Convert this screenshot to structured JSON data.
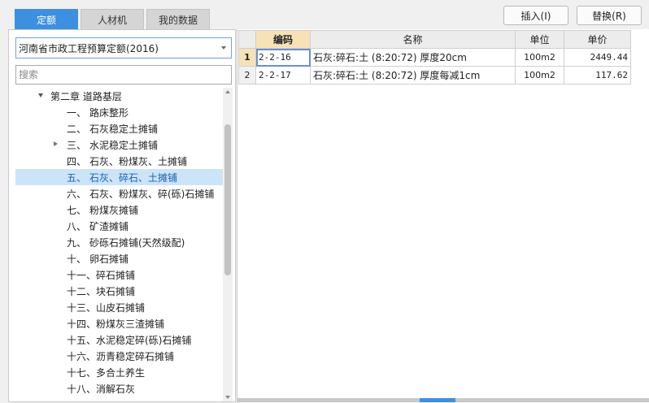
{
  "tabs": [
    {
      "label": "定额",
      "active": true
    },
    {
      "label": "人材机",
      "active": false
    },
    {
      "label": "我的数据",
      "active": false
    }
  ],
  "toolbar": {
    "insert_label": "插入(I)",
    "replace_label": "替换(R)"
  },
  "left": {
    "selected_library": "河南省市政工程预算定额(2016)",
    "search_placeholder": "搜索",
    "tree": [
      {
        "num": "",
        "label": "第二章 道路基层",
        "level": 1,
        "expanded": true
      },
      {
        "num": "一、",
        "label": "路床整形",
        "level": 2
      },
      {
        "num": "二、",
        "label": "石灰稳定土摊铺",
        "level": 2
      },
      {
        "num": "三、",
        "label": "水泥稳定土摊铺",
        "level": 2,
        "has_children": true
      },
      {
        "num": "四、",
        "label": "石灰、粉煤灰、土摊铺",
        "level": 2
      },
      {
        "num": "五、",
        "label": "石灰、碎石、土摊铺",
        "level": 2,
        "selected": true
      },
      {
        "num": "六、",
        "label": "石灰、粉煤灰、碎(砾)石摊铺",
        "level": 2
      },
      {
        "num": "七、",
        "label": "粉煤灰摊铺",
        "level": 2
      },
      {
        "num": "八、",
        "label": "矿渣摊铺",
        "level": 2
      },
      {
        "num": "九、",
        "label": "砂砾石摊铺(天然级配)",
        "level": 2
      },
      {
        "num": "十、",
        "label": "卵石摊铺",
        "level": 2
      },
      {
        "num": "十一、",
        "label": "碎石摊铺",
        "level": 2
      },
      {
        "num": "十二、",
        "label": "块石摊铺",
        "level": 2
      },
      {
        "num": "十三、",
        "label": "山皮石摊铺",
        "level": 2
      },
      {
        "num": "十四、",
        "label": "粉煤灰三渣摊铺",
        "level": 2
      },
      {
        "num": "十五、",
        "label": "水泥稳定碎(砾)石摊铺",
        "level": 2
      },
      {
        "num": "十六、",
        "label": "沥青稳定碎石摊铺",
        "level": 2
      },
      {
        "num": "十七、",
        "label": "多合土养生",
        "level": 2
      },
      {
        "num": "十八、",
        "label": "消解石灰",
        "level": 2
      }
    ]
  },
  "grid": {
    "headers": [
      "编码",
      "名称",
      "单位",
      "单价"
    ],
    "rows": [
      {
        "index": "1",
        "code": "2-2-16",
        "name": "石灰:碎石:土 (8:20:72) 厚度20cm",
        "unit": "100m2",
        "price": "2449.44"
      },
      {
        "index": "2",
        "code": "2-2-17",
        "name": "石灰:碎石:土 (8:20:72) 厚度每减1cm",
        "unit": "100m2",
        "price": "117.62"
      }
    ]
  }
}
